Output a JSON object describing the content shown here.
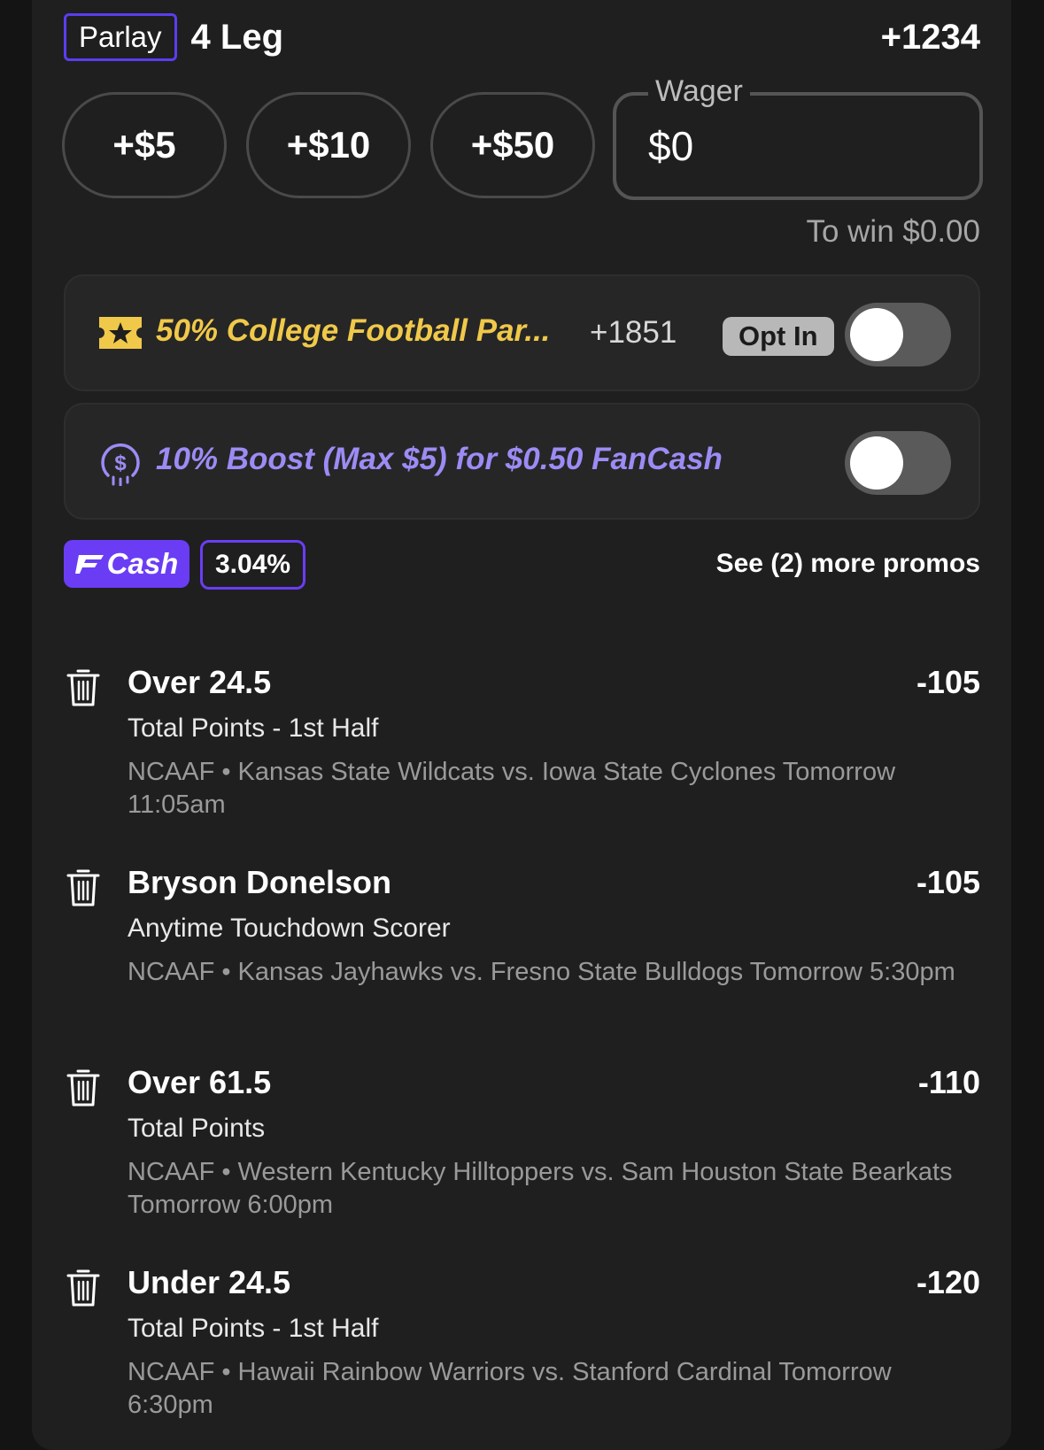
{
  "header": {
    "badge": "Parlay",
    "legs": "4 Leg",
    "odds": "+1234"
  },
  "wager": {
    "chips": [
      "+$5",
      "+$10",
      "+$50"
    ],
    "label": "Wager",
    "value": "$0",
    "to_win": "To win $0.00"
  },
  "promos": [
    {
      "icon": "star-ticket-icon",
      "text": "50% College Football Par...",
      "odds": "+1851",
      "opt_in": "Opt In",
      "enabled": false,
      "color": "#f0c94a"
    },
    {
      "icon": "dollar-coin-icon",
      "text": "10% Boost (Max $5) for $0.50 FanCash",
      "enabled": false,
      "color": "#9d8bf5"
    }
  ],
  "fancash": {
    "label": "Cash",
    "percent": "3.04%",
    "more_promos": "See (2) more promos",
    "accent": "#6a3df5"
  },
  "legs": [
    {
      "title": "Over 24.5",
      "odds": "-105",
      "market": "Total Points - 1st Half",
      "event": "NCAAF • Kansas State Wildcats vs. Iowa State Cyclones Tomorrow 11:05am"
    },
    {
      "title": "Bryson Donelson",
      "odds": "-105",
      "market": "Anytime Touchdown Scorer",
      "event": "NCAAF • Kansas Jayhawks vs. Fresno State Bulldogs Tomorrow 5:30pm"
    },
    {
      "title": "Over 61.5",
      "odds": "-110",
      "market": "Total Points",
      "event": "NCAAF • Western Kentucky Hilltoppers vs. Sam Houston State Bearkats Tomorrow 6:00pm"
    },
    {
      "title": "Under 24.5",
      "odds": "-120",
      "market": "Total Points - 1st Half",
      "event": "NCAAF • Hawaii Rainbow Warriors vs. Stanford Cardinal Tomorrow 6:30pm"
    }
  ]
}
